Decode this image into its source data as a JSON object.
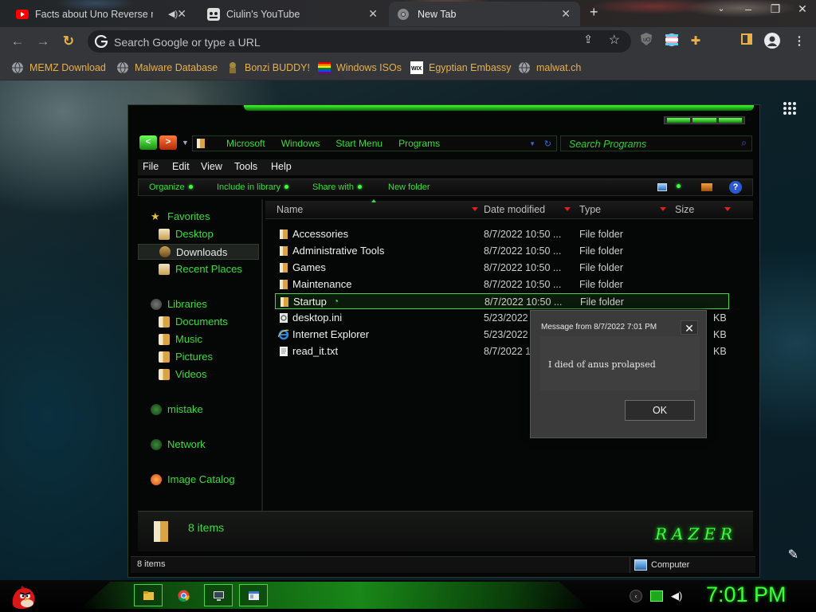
{
  "browser": {
    "tabs": [
      {
        "title": "Facts about Uno Reverse m",
        "active": false,
        "icon": "youtube-icon",
        "audio": true
      },
      {
        "title": "Ciulin's YouTube",
        "active": false,
        "icon": "custom-favicon-icon"
      },
      {
        "title": "New Tab",
        "active": true,
        "icon": "chrome-icon"
      }
    ],
    "omnibox_placeholder": "Search Google or type a URL",
    "bookmarks": [
      {
        "label": "MEMZ Download",
        "icon": "globe-icon"
      },
      {
        "label": "Malware Database",
        "icon": "globe-icon"
      },
      {
        "label": "Bonzi BUDDY!",
        "icon": "bonzi-icon"
      },
      {
        "label": "Windows ISOs",
        "icon": "rainbow-icon"
      },
      {
        "label": "Egyptian Embassy",
        "icon": "wix-icon"
      },
      {
        "label": "malwat.ch",
        "icon": "globe-icon"
      }
    ],
    "accent": "#e8b04a"
  },
  "explorer": {
    "breadcrumbs": [
      "Microsoft",
      "Windows",
      "Start Menu",
      "Programs"
    ],
    "search_placeholder": "Search Programs",
    "menu": [
      "File",
      "Edit",
      "View",
      "Tools",
      "Help"
    ],
    "commands": [
      "Organize",
      "Include in library",
      "Share with",
      "New folder"
    ],
    "nav": {
      "favorites": {
        "title": "Favorites",
        "items": [
          "Desktop",
          "Downloads",
          "Recent Places"
        ],
        "selected": "Downloads"
      },
      "libraries": {
        "title": "Libraries",
        "items": [
          "Documents",
          "Music",
          "Pictures",
          "Videos"
        ]
      },
      "homegroup": "mistake",
      "network": "Network",
      "catalog": "Image Catalog"
    },
    "columns": [
      "Name",
      "Date modified",
      "Type",
      "Size"
    ],
    "files": [
      {
        "name": "Accessories",
        "date": "8/7/2022 10:50 ...",
        "type": "File folder",
        "size": "",
        "icon": "folder-icon"
      },
      {
        "name": "Administrative Tools",
        "date": "8/7/2022 10:50 ...",
        "type": "File folder",
        "size": "",
        "icon": "folder-icon"
      },
      {
        "name": "Games",
        "date": "8/7/2022 10:50 ...",
        "type": "File folder",
        "size": "",
        "icon": "folder-icon"
      },
      {
        "name": "Maintenance",
        "date": "8/7/2022 10:50 ...",
        "type": "File folder",
        "size": "",
        "icon": "folder-icon"
      },
      {
        "name": "Startup",
        "date": "8/7/2022 10:50 ...",
        "type": "File folder",
        "size": "",
        "icon": "folder-icon",
        "selected": true
      },
      {
        "name": "desktop.ini",
        "date": "5/23/2022",
        "type": "",
        "size": "KB",
        "icon": "settings-file-icon"
      },
      {
        "name": "Internet Explorer",
        "date": "5/23/2022",
        "type": "",
        "size": "KB",
        "icon": "ie-icon"
      },
      {
        "name": "read_it.txt",
        "date": "8/7/2022 1",
        "type": "",
        "size": "KB",
        "icon": "text-file-icon"
      }
    ],
    "details_count": "8 items",
    "brand": "RAZER",
    "status_left": "8 items",
    "status_right": "Computer",
    "accent": "#3cdc3c"
  },
  "dialog": {
    "title": "Message from  8/7/2022 7:01 PM",
    "message": "I died of anus prolapsed",
    "ok_label": "OK"
  },
  "taskbar": {
    "clock": "7:01 PM",
    "pinned": [
      "explorer-icon",
      "chrome-icon",
      "network-monitor-icon",
      "window-icon"
    ],
    "tray": [
      "back-icon",
      "battery-icon",
      "volume-icon"
    ]
  }
}
